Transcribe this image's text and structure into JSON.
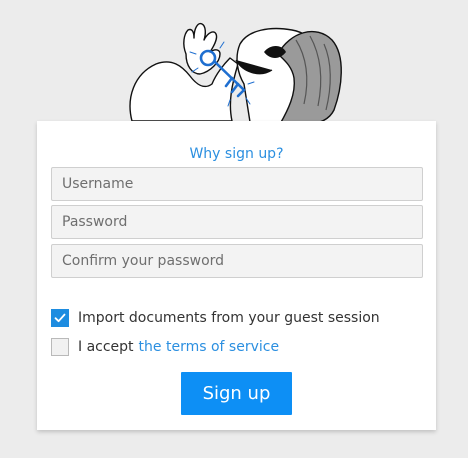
{
  "header": {
    "illustration_icon": "character-with-key-icon"
  },
  "form": {
    "why_link": "Why sign up?",
    "username_placeholder": "Username",
    "password_placeholder": "Password",
    "confirm_placeholder": "Confirm your password",
    "import_checkbox": {
      "label": "Import documents from your guest session",
      "checked": true
    },
    "terms_checkbox": {
      "label_prefix": "I accept",
      "link_text": "the terms of service",
      "checked": false
    },
    "submit_label": "Sign up"
  },
  "colors": {
    "accent": "#0d8ff5",
    "link": "#2b8fe0",
    "background": "#ececec"
  }
}
